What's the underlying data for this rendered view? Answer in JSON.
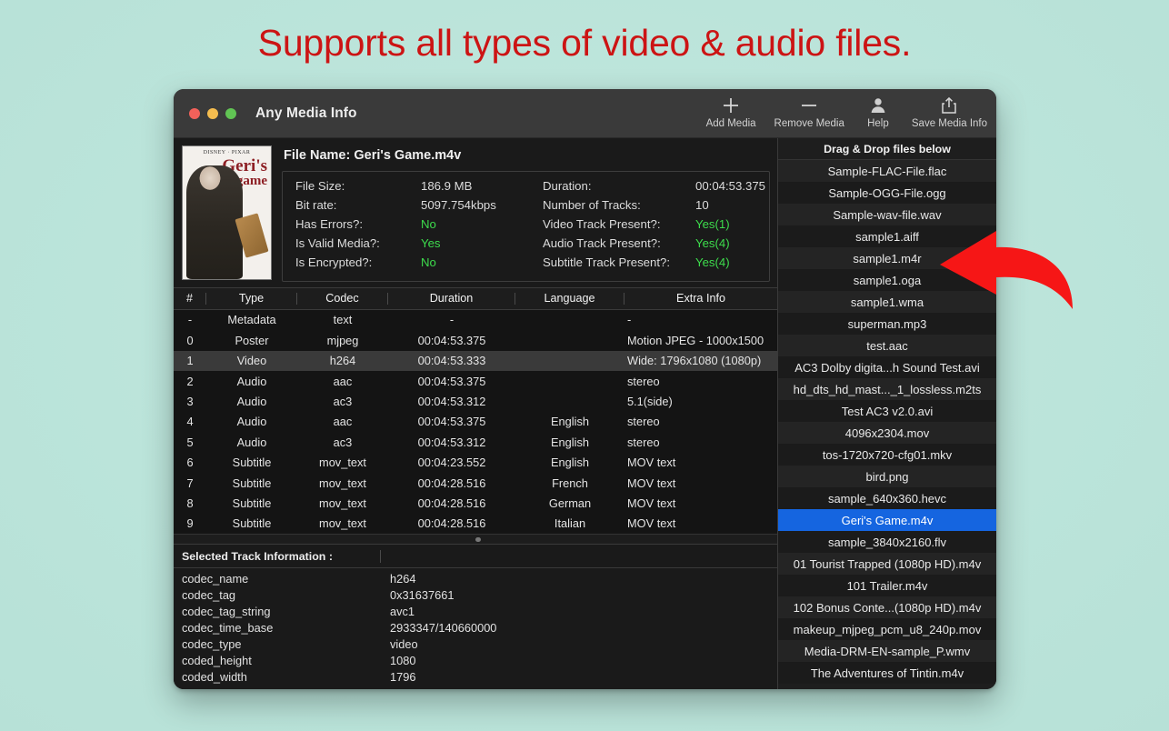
{
  "headline": "Supports all types of video & audio files.",
  "colors": {
    "page_background": "#bfe6de",
    "headline_red": "#cc1414",
    "arrow_red": "#f61616",
    "window_background": "#1c1c1c",
    "titlebar": "#3a3a3a",
    "selection_blue": "#1565e0",
    "value_green": "#3ddc4c"
  },
  "window": {
    "title": "Any Media Info",
    "traffic_lights": [
      "close-red",
      "minimize-yellow",
      "zoom-green"
    ]
  },
  "toolbar": {
    "items": [
      {
        "icon": "plus-icon",
        "label": "Add Media"
      },
      {
        "icon": "minus-icon",
        "label": "Remove Media"
      },
      {
        "icon": "person-icon",
        "label": "Help"
      },
      {
        "icon": "share-upload-icon",
        "label": "Save Media Info"
      }
    ]
  },
  "summary": {
    "poster": {
      "brand": "DISNEY · PIXAR",
      "title_line1": "Geri's",
      "title_line2": "game"
    },
    "file_name_label": "File Name: Geri's Game.m4v",
    "fields": [
      {
        "key": "File Size:",
        "value": "186.9 MB",
        "green": false,
        "key2": "Duration:",
        "value2": "00:04:53.375",
        "green2": false
      },
      {
        "key": "Bit rate:",
        "value": "5097.754kbps",
        "green": false,
        "key2": "Number of Tracks:",
        "value2": "10",
        "green2": false
      },
      {
        "key": "Has Errors?:",
        "value": "No",
        "green": true,
        "key2": "Video Track Present?:",
        "value2": "Yes(1)",
        "green2": true
      },
      {
        "key": "Is Valid Media?:",
        "value": "Yes",
        "green": true,
        "key2": "Audio Track Present?:",
        "value2": "Yes(4)",
        "green2": true
      },
      {
        "key": "Is Encrypted?:",
        "value": "No",
        "green": true,
        "key2": "Subtitle Track Present?:",
        "value2": "Yes(4)",
        "green2": true
      }
    ]
  },
  "tracks_table": {
    "headers": [
      "#",
      "Type",
      "Codec",
      "Duration",
      "Language",
      "Extra Info"
    ],
    "selected_index": 2,
    "rows": [
      {
        "num": "-",
        "type": "Metadata",
        "codec": "text",
        "duration": "-",
        "language": "",
        "extra": "-"
      },
      {
        "num": "0",
        "type": "Poster",
        "codec": "mjpeg",
        "duration": "00:04:53.375",
        "language": "",
        "extra": "Motion JPEG - 1000x1500"
      },
      {
        "num": "1",
        "type": "Video",
        "codec": "h264",
        "duration": "00:04:53.333",
        "language": "",
        "extra": "Wide: 1796x1080 (1080p)"
      },
      {
        "num": "2",
        "type": "Audio",
        "codec": "aac",
        "duration": "00:04:53.375",
        "language": "",
        "extra": "stereo"
      },
      {
        "num": "3",
        "type": "Audio",
        "codec": "ac3",
        "duration": "00:04:53.312",
        "language": "",
        "extra": "5.1(side)"
      },
      {
        "num": "4",
        "type": "Audio",
        "codec": "aac",
        "duration": "00:04:53.375",
        "language": "English",
        "extra": "stereo"
      },
      {
        "num": "5",
        "type": "Audio",
        "codec": "ac3",
        "duration": "00:04:53.312",
        "language": "English",
        "extra": "stereo"
      },
      {
        "num": "6",
        "type": "Subtitle",
        "codec": "mov_text",
        "duration": "00:04:23.552",
        "language": "English",
        "extra": "MOV text"
      },
      {
        "num": "7",
        "type": "Subtitle",
        "codec": "mov_text",
        "duration": "00:04:28.516",
        "language": "French",
        "extra": "MOV text"
      },
      {
        "num": "8",
        "type": "Subtitle",
        "codec": "mov_text",
        "duration": "00:04:28.516",
        "language": "German",
        "extra": "MOV text"
      },
      {
        "num": "9",
        "type": "Subtitle",
        "codec": "mov_text",
        "duration": "00:04:28.516",
        "language": "Italian",
        "extra": "MOV text"
      }
    ]
  },
  "selected_track": {
    "header": "Selected Track Information :",
    "rows": [
      {
        "key": "codec_name",
        "value": "h264"
      },
      {
        "key": "codec_tag",
        "value": "0x31637661"
      },
      {
        "key": "codec_tag_string",
        "value": "avc1"
      },
      {
        "key": "codec_time_base",
        "value": "2933347/140660000"
      },
      {
        "key": "codec_type",
        "value": "video"
      },
      {
        "key": "coded_height",
        "value": "1080"
      },
      {
        "key": "coded_width",
        "value": "1796"
      }
    ]
  },
  "file_list": {
    "header": "Drag & Drop files below",
    "selected": "Geri's Game.m4v",
    "items": [
      "Sample-FLAC-File.flac",
      "Sample-OGG-File.ogg",
      "Sample-wav-file.wav",
      "sample1.aiff",
      "sample1.m4r",
      "sample1.oga",
      "sample1.wma",
      "superman.mp3",
      "test.aac",
      "AC3 Dolby digita...h Sound Test.avi",
      "hd_dts_hd_mast..._1_lossless.m2ts",
      "Test AC3 v2.0.avi",
      "4096x2304.mov",
      "tos-1720x720-cfg01.mkv",
      "bird.png",
      "sample_640x360.hevc",
      "Geri's Game.m4v",
      "sample_3840x2160.flv",
      "01 Tourist Trapped (1080p HD).m4v",
      "101 Trailer.m4v",
      "102 Bonus Conte...(1080p HD).m4v",
      "makeup_mjpeg_pcm_u8_240p.mov",
      "Media-DRM-EN-sample_P.wmv",
      "The Adventures of Tintin.m4v"
    ]
  },
  "annotation": {
    "arrow": "red-curved-arrow-pointing-left"
  }
}
